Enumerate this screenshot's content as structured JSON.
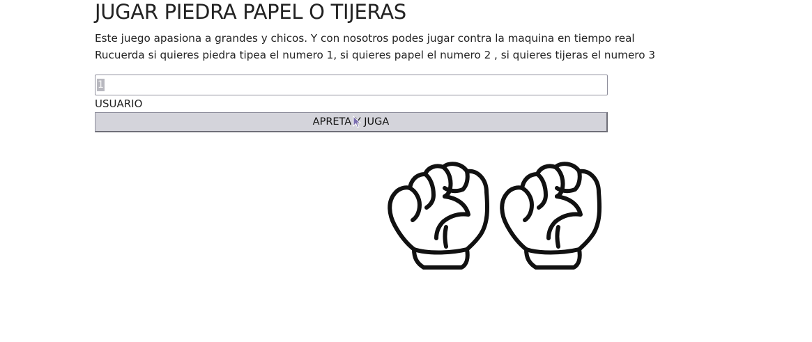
{
  "page": {
    "title": "JUGAR PIEDRA PAPEL O TIJERAS",
    "description_line1": "Este juego apasiona a grandes y chicos. Y con nosotros podes jugar contra la maquina en tiempo real",
    "description_line2": "Rucuerda si quieres piedra tipea el numero 1, si quieres papel el numero 2 , si quieres tijeras el numero 3"
  },
  "form": {
    "input_value": "1",
    "input_label": "USUARIO",
    "button_label": "APRETA Y JUGA"
  },
  "result": {
    "user_choice_icon": "rock-fist-icon",
    "machine_choice_icon": "rock-fist-icon"
  }
}
